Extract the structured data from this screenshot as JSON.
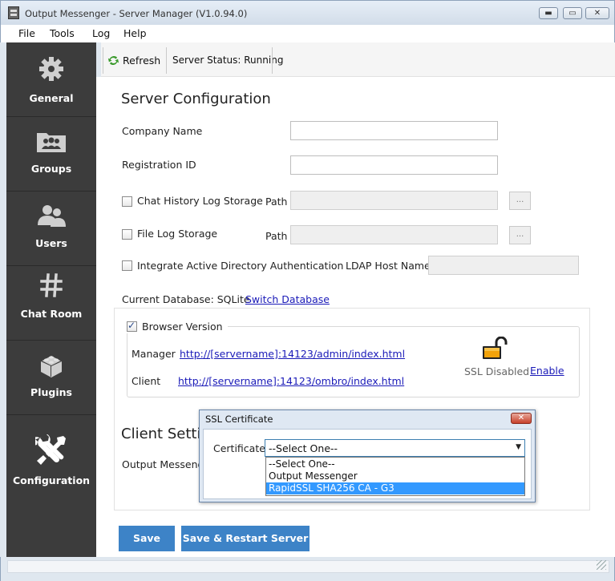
{
  "window": {
    "title": "Output Messenger - Server Manager  (V1.0.94.0)",
    "min_glyph": "▬",
    "max_glyph": "▭",
    "close_glyph": "✕"
  },
  "menu": [
    "File",
    "Tools",
    "Log",
    "Help"
  ],
  "sidebar": {
    "items": [
      {
        "label": "General",
        "icon": "gear-icon"
      },
      {
        "label": "Groups",
        "icon": "groups-icon"
      },
      {
        "label": "Users",
        "icon": "users-icon"
      },
      {
        "label": "Chat Room",
        "icon": "hash-icon"
      },
      {
        "label": "Plugins",
        "icon": "plugins-icon"
      },
      {
        "label": "Configuration",
        "icon": "wrench-screwdriver-icon"
      }
    ],
    "active": "Configuration"
  },
  "toolbar": {
    "refresh_label": "Refresh",
    "status_text": "Server Status: Running"
  },
  "server_config": {
    "title": "Server Configuration",
    "company_name_label": "Company Name",
    "registration_id_label": "Registration ID",
    "chat_history_label": "Chat History Log Storage",
    "file_log_label": "File Log Storage",
    "path_label": "Path",
    "browse_label": "...",
    "ad_auth_label": "Integrate Active Directory Authentication",
    "ldap_label": "LDAP Host Name",
    "current_db_label": "Current Database: SQLite",
    "switch_db_link": "Switch Database"
  },
  "browser_version": {
    "label": "Browser Version",
    "checked": true,
    "manager_label": "Manager",
    "manager_url": "http://[servername]:14123/admin/index.html",
    "client_label": "Client",
    "client_url": "http://[servername]:14123/ombro/index.html",
    "ssl_status": "SSL Disabled",
    "enable_link": "Enable",
    "lock_color": "#f2a20a"
  },
  "client_settings": {
    "title": "Client Settin",
    "output_messenger_label": "Output Messeng"
  },
  "buttons": {
    "save": "Save",
    "save_restart": "Save & Restart Server"
  },
  "ssl_dialog": {
    "title": "SSL Certificate",
    "close_glyph": "✕",
    "certificate_label": "Certificate",
    "selected_value": "--Select One--",
    "options": [
      "--Select One--",
      "Output Messenger",
      "RapidSSL SHA256 CA - G3"
    ],
    "highlighted_option": "RapidSSL SHA256 CA - G3"
  },
  "colors": {
    "sidebar_bg": "#3c3c3c",
    "primary_button": "#3d83c7",
    "link": "#1a1ab8",
    "highlight": "#3399ff"
  }
}
